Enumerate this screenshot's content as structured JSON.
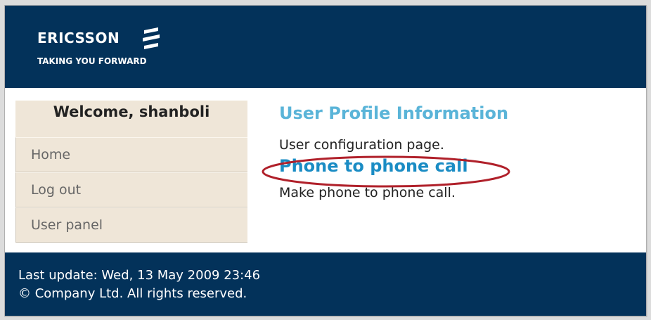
{
  "header": {
    "logo_text": "ERICSSON",
    "tagline": "TAKING YOU FORWARD",
    "logo_icon": "ericsson-stripes-icon",
    "bg_color": "#03325a"
  },
  "sidebar": {
    "welcome": "Welcome, shanboli",
    "items": [
      {
        "label": "Home"
      },
      {
        "label": "Log out"
      },
      {
        "label": "User panel"
      }
    ],
    "bg_color": "#efe6d8"
  },
  "main": {
    "sections": [
      {
        "title": "User Profile Information",
        "desc": "User configuration page."
      },
      {
        "title": "Phone to phone call",
        "desc": "Make phone to phone call."
      }
    ],
    "highlight_color": "#b0202a"
  },
  "footer": {
    "last_update": "Last update: Wed, 13 May 2009 23:46",
    "copyright": "© Company Ltd. All rights reserved."
  }
}
